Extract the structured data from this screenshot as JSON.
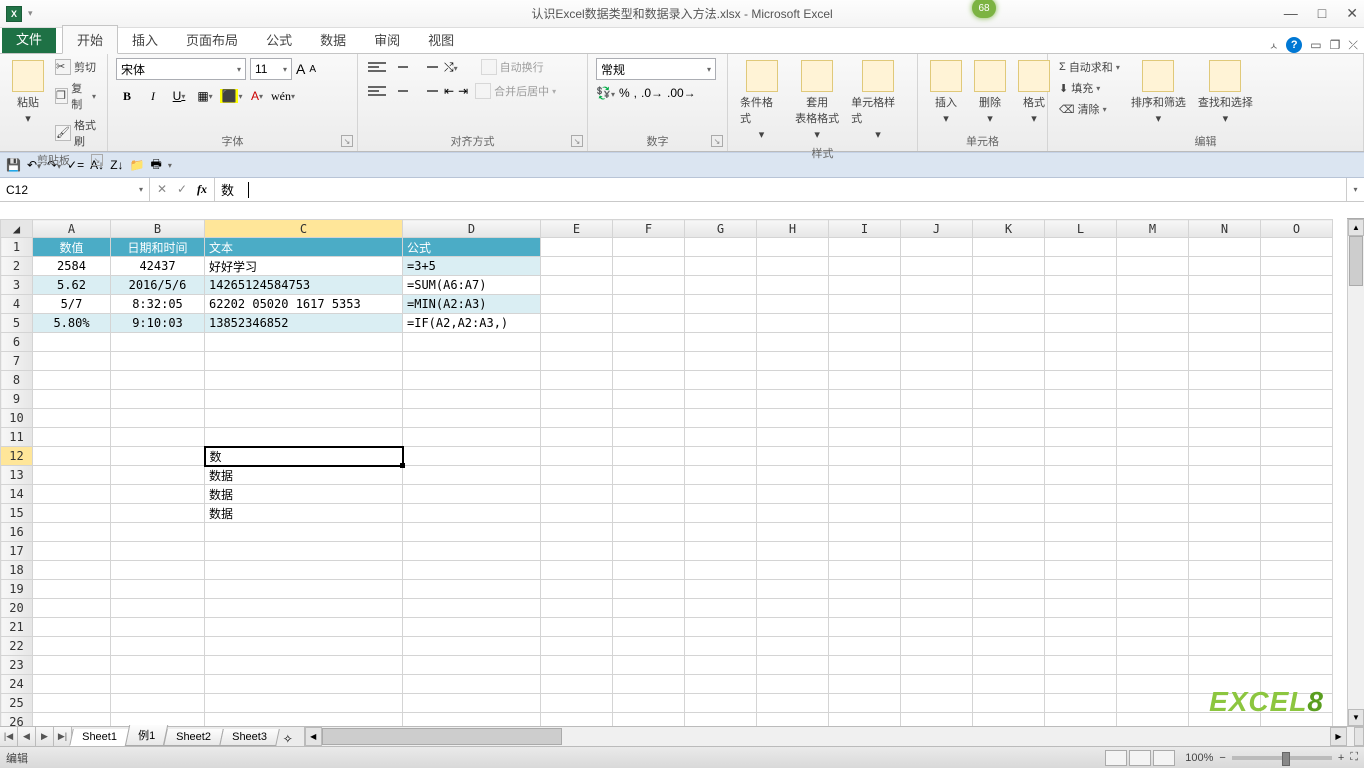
{
  "titlebar": {
    "app_initial": "X",
    "title": "认识Excel数据类型和数据录入方法.xlsx - Microsoft Excel",
    "badge": "68"
  },
  "tabs": {
    "file": "文件",
    "home": "开始",
    "insert": "插入",
    "layout": "页面布局",
    "formulas": "公式",
    "data": "数据",
    "review": "审阅",
    "view": "视图"
  },
  "ribbon": {
    "clipboard": {
      "label": "剪贴板",
      "paste": "粘贴",
      "cut": "剪切",
      "copy": "复制",
      "painter": "格式刷"
    },
    "font": {
      "label": "字体",
      "name": "宋体",
      "size": "11",
      "grow": "A",
      "shrink": "A",
      "bold": "B",
      "italic": "I",
      "under": "U"
    },
    "align": {
      "label": "对齐方式",
      "wrap": "自动换行",
      "merge": "合并后居中"
    },
    "number": {
      "label": "数字",
      "format": "常规"
    },
    "styles": {
      "label": "样式",
      "cond": "条件格式",
      "table": "套用\n表格格式",
      "cell": "单元格样式"
    },
    "cells": {
      "label": "单元格",
      "insert": "插入",
      "delete": "删除",
      "format": "格式"
    },
    "editing": {
      "label": "编辑",
      "sum": "自动求和",
      "fill": "填充",
      "clear": "清除",
      "sort": "排序和筛选",
      "find": "查找和选择"
    }
  },
  "namebox": "C12",
  "formula_text": "数",
  "columns": [
    "A",
    "B",
    "C",
    "D",
    "E",
    "F",
    "G",
    "H",
    "I",
    "J",
    "K",
    "L",
    "M",
    "N",
    "O"
  ],
  "rows": {
    "r1": {
      "A": "数值",
      "B": "日期和时间",
      "C": "文本",
      "D": "公式"
    },
    "r2": {
      "A": "2584",
      "B": "42437",
      "C": "好好学习",
      "D": "=3+5"
    },
    "r3": {
      "A": "5.62",
      "B": "2016/5/6",
      "C": "14265124584753",
      "D": "=SUM(A6:A7)"
    },
    "r4": {
      "A": "5/7",
      "B": "8:32:05",
      "C": "62202 05020 1617 5353",
      "D": "=MIN(A2:A3)"
    },
    "r5": {
      "A": "5.80%",
      "B": "9:10:03",
      "C": "13852346852",
      "D": "=IF(A2,A2:A3,)"
    },
    "r12": {
      "C": "数"
    },
    "r13": {
      "C": "数据"
    },
    "r14": {
      "C": "数据"
    },
    "r15": {
      "C": "数据"
    }
  },
  "sheets": {
    "s1": "Sheet1",
    "s2": "例1",
    "s3": "Sheet2",
    "s4": "Sheet3"
  },
  "status": {
    "mode": "编辑",
    "zoom": "100%"
  },
  "watermark": {
    "a": "EXCEL",
    "b": "8"
  }
}
